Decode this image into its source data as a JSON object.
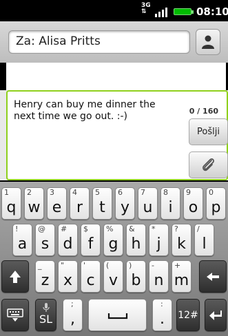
{
  "status_bar": {
    "network": "3G",
    "time": "08:10",
    "colors": {
      "battery": "#00bb00"
    },
    "icons": [
      "data-arrows-icon",
      "signal-icon",
      "battery-icon"
    ]
  },
  "recipient": {
    "to_text": "Za: Alisa Pritts",
    "contact_icon": "person-icon"
  },
  "compose": {
    "message": "Henry can buy me dinner the next time we go out.  :-)",
    "char_count": "0 / 160",
    "send_label": "Pošlji",
    "attach_icon": "paperclip-icon",
    "accent": "#8fd01c"
  },
  "keyboard": {
    "row1": [
      {
        "sub": "1",
        "main": "q"
      },
      {
        "sub": "2",
        "main": "w"
      },
      {
        "sub": "3",
        "main": "e"
      },
      {
        "sub": "4",
        "main": "r"
      },
      {
        "sub": "5",
        "main": "t"
      },
      {
        "sub": "6",
        "main": "y"
      },
      {
        "sub": "7",
        "main": "u"
      },
      {
        "sub": "8",
        "main": "i"
      },
      {
        "sub": "9",
        "main": "o"
      },
      {
        "sub": "0",
        "main": "p"
      }
    ],
    "row2": [
      {
        "sub": "!",
        "main": "a"
      },
      {
        "sub": "@",
        "main": "s"
      },
      {
        "sub": "#",
        "main": "d"
      },
      {
        "sub": "$",
        "main": "f"
      },
      {
        "sub": "%",
        "main": "g"
      },
      {
        "sub": "&",
        "main": "h"
      },
      {
        "sub": "*",
        "main": "j"
      },
      {
        "sub": "?",
        "main": "k"
      },
      {
        "sub": "/",
        "main": "l"
      }
    ],
    "row3": [
      {
        "sub": "_",
        "main": "z"
      },
      {
        "sub": "\"",
        "main": "x"
      },
      {
        "sub": "'",
        "main": "c"
      },
      {
        "sub": "(",
        "main": "v"
      },
      {
        "sub": ")",
        "main": "b"
      },
      {
        "sub": "-",
        "main": "n"
      },
      {
        "sub": "+",
        "main": "m"
      }
    ],
    "row4": {
      "mic_label": "SL",
      "semicolon": ";",
      "comma": ",",
      "colon": ":",
      "period": ".",
      "symbols_label": "12#"
    }
  }
}
